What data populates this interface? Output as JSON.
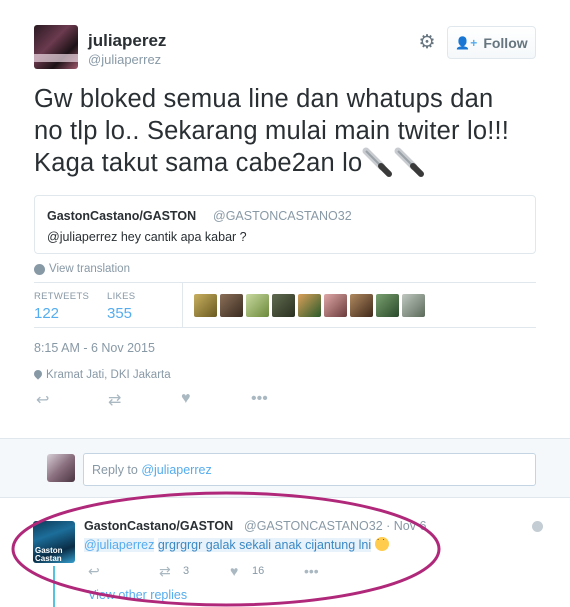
{
  "tweet": {
    "fullname": "juliaperez",
    "username": "@juliaperrez",
    "follow_label": "Follow",
    "text_lines": [
      "Gw bloked semua line dan whatups dan",
      "no tlp lo.. Sekarang mulai main twiter lo!!!",
      "Kaga takut sama cabe2an lo"
    ],
    "quote": {
      "name": "GastonCastano/GASTON",
      "handle": "@GASTONCASTANO32",
      "text": "@juliaperrez hey cantik apa kabar ?"
    },
    "view_translation": "View translation",
    "stats": {
      "retweets_label": "RETWEETS",
      "retweets": "122",
      "likes_label": "LIKES",
      "likes": "355"
    },
    "timestamp": "8:15 AM - 6 Nov 2015",
    "location": "Kramat Jati, DKI Jakarta",
    "icons": [
      "reply-icon",
      "retweet-icon",
      "like-icon",
      "more-icon"
    ]
  },
  "reply_box": {
    "prefix": "Reply to ",
    "mention": "@juliaperrez"
  },
  "reply_tweet": {
    "name": "GastonCastano/GASTON",
    "handle": "@GASTONCASTANO32 · Nov 6",
    "mention": "@juliaperrez",
    "text": "grgrgrgr galak sekali anak cijantung lni",
    "avatar_text": "Gaston Castan",
    "retweets": "3",
    "likes": "16",
    "other_replies": "View other replies"
  },
  "colors": {
    "accent": "#55acee",
    "muted": "#8899a6",
    "highlight_ellipse": "#b0287a"
  }
}
